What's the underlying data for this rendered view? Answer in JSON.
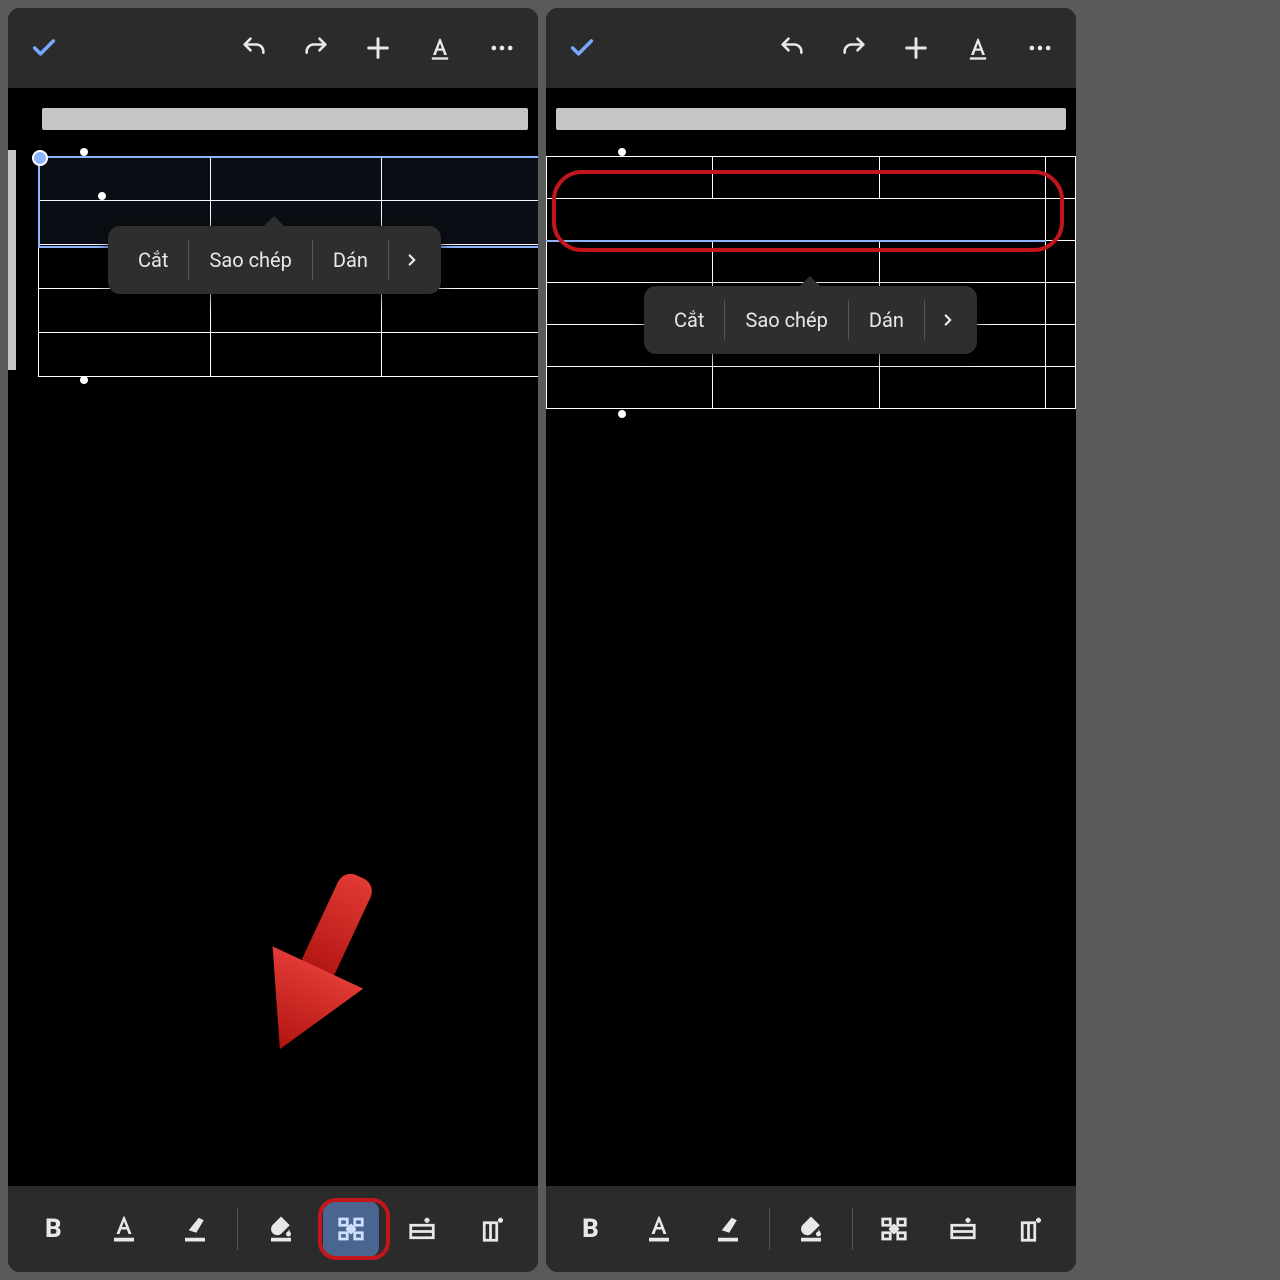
{
  "topbar": {},
  "context_menu": {
    "cut": "Cắt",
    "copy": "Sao chép",
    "paste": "Dán"
  },
  "bottombar": {
    "bold": "B"
  },
  "annotations": {
    "highlight_button": "merge-cells-button",
    "highlight_row": "merged-table-row"
  }
}
